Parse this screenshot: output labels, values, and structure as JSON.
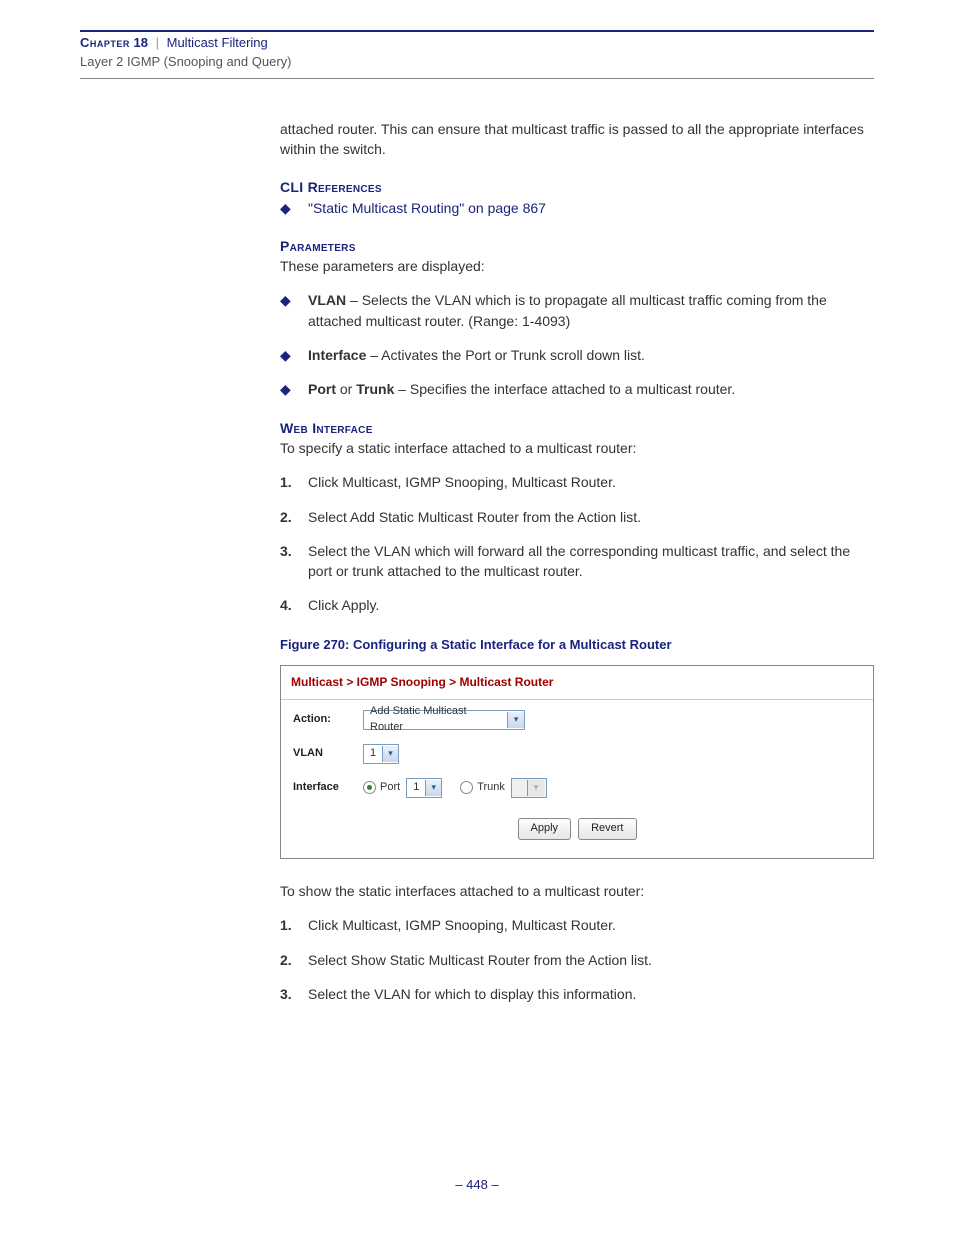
{
  "header": {
    "chapter_word": "Chapter",
    "chapter_num": "18",
    "sep": "|",
    "chapter_title": "Multicast Filtering",
    "sub": "Layer 2 IGMP (Snooping and Query)"
  },
  "intro": "attached router. This can ensure that multicast traffic is passed to all the appropriate interfaces within the switch.",
  "cli": {
    "head": "CLI References",
    "link": "\"Static Multicast Routing\" on page 867"
  },
  "params": {
    "head": "Parameters",
    "intro": "These parameters are displayed:",
    "items": [
      {
        "bold": "VLAN",
        "rest": " – Selects the VLAN which is to propagate all multicast traffic coming from the attached multicast router. (Range: 1-4093)"
      },
      {
        "bold": "Interface",
        "rest": " – Activates the Port or Trunk scroll down list."
      },
      {
        "bold": "Port",
        "mid": " or ",
        "bold2": "Trunk",
        "rest": " – Specifies the interface attached to a multicast router."
      }
    ]
  },
  "web": {
    "head": "Web Interface",
    "intro": "To specify a static interface attached to a multicast router:",
    "steps": [
      "Click Multicast, IGMP Snooping, Multicast Router.",
      "Select Add Static Multicast Router from the Action list.",
      "Select the VLAN which will forward all the corresponding multicast traffic, and select the port or trunk attached to the multicast router.",
      "Click Apply."
    ]
  },
  "figure": {
    "caption": "Figure 270:  Configuring a Static Interface for a Multicast Router",
    "breadcrumb": "Multicast > IGMP Snooping > Multicast Router",
    "action_label": "Action:",
    "action_value": "Add Static Multicast Router",
    "vlan_label": "VLAN",
    "vlan_value": "1",
    "iface_label": "Interface",
    "port_label": "Port",
    "port_value": "1",
    "trunk_label": "Trunk",
    "apply": "Apply",
    "revert": "Revert"
  },
  "show": {
    "intro": "To show the static interfaces attached to a multicast router:",
    "steps": [
      "Click Multicast, IGMP Snooping, Multicast Router.",
      "Select Show Static Multicast Router from the Action list.",
      "Select the VLAN for which to display this information."
    ]
  },
  "page_num": "–  448  –"
}
